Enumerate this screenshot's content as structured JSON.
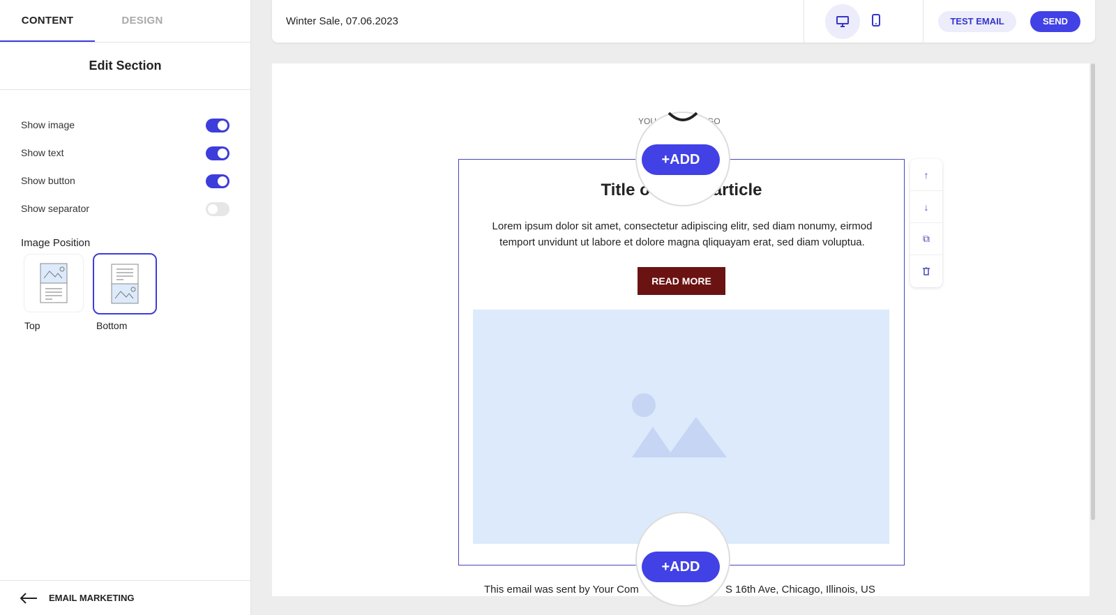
{
  "sidebar": {
    "tabs": [
      {
        "label": "CONTENT"
      },
      {
        "label": "DESIGN"
      }
    ],
    "title": "Edit Section",
    "options": [
      {
        "label": "Show image",
        "on": true
      },
      {
        "label": "Show text",
        "on": true
      },
      {
        "label": "Show button",
        "on": true
      },
      {
        "label": "Show separator",
        "on": false
      }
    ],
    "image_position_label": "Image Position",
    "positions": [
      {
        "label": "Top"
      },
      {
        "label": "Bottom",
        "selected": true
      }
    ],
    "back_label": "EMAIL MARKETING"
  },
  "topbar": {
    "title": "Winter Sale, 07.06.2023",
    "test_email": "TEST EMAIL",
    "send": "SEND",
    "view": "desktop"
  },
  "email": {
    "logo_left": "YOU",
    "logo_right": "GO",
    "title_left": "Title o",
    "title_right": "article",
    "body": "Lorem ipsum dolor sit amet, consectetur adipiscing elitr, sed diam nonumy, eirmod temport unvidunt ut labore et dolore magna qliquayam erat, sed diam voluptua.",
    "button": "READ MORE",
    "button_color": "#6b1212",
    "add": "+ADD",
    "footer_left": "This email was sent by Your Com",
    "footer_right": "S 16th Ave, Chicago, Illinois, US"
  },
  "colors": {
    "accent": "#3d3ddb"
  }
}
